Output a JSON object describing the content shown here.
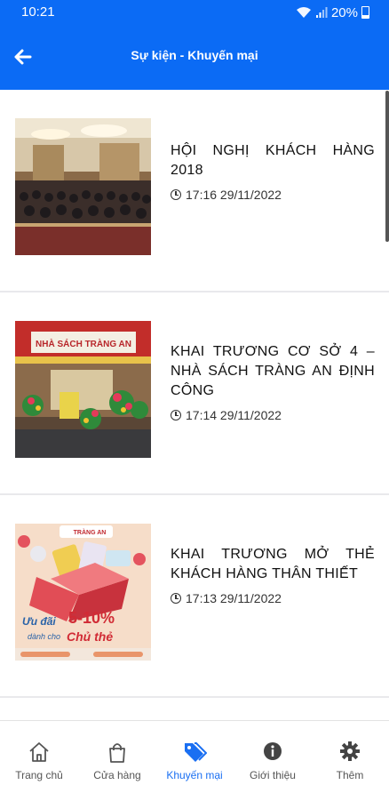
{
  "status_bar": {
    "time": "10:21",
    "battery": "20%"
  },
  "header": {
    "title": "Sự kiện - Khuyến mại",
    "back_icon": "arrow-left-icon"
  },
  "articles": [
    {
      "title": "HỘI NGHỊ KHÁCH HÀNG 2018",
      "time": "17:16 29/11/2022",
      "image": "conference-photo"
    },
    {
      "title": "KHAI TRƯƠNG CƠ SỞ 4 – NHÀ SÁCH TRÀNG AN ĐỊNH CÔNG",
      "time": "17:14 29/11/2022",
      "image": "store-opening-photo",
      "image_text": "NHÀ SÁCH TRÀNG AN"
    },
    {
      "title": "KHAI TRƯƠNG MỞ THẺ KHÁCH HÀNG THÂN THIẾT",
      "time": "17:13 29/11/2022",
      "image": "membership-card-promo",
      "image_text": {
        "brand": "TRÀNG AN",
        "promo_a": "Ưu đãi",
        "promo_b": "5-10%",
        "promo_c": "dành cho",
        "promo_d": "Chủ thẻ"
      }
    }
  ],
  "bottom_nav": [
    {
      "label": "Trang chủ",
      "icon": "home-icon"
    },
    {
      "label": "Cửa hàng",
      "icon": "shopping-bag-icon"
    },
    {
      "label": "Khuyến mại",
      "icon": "tags-icon",
      "active": true
    },
    {
      "label": "Giới thiệu",
      "icon": "info-icon"
    },
    {
      "label": "Thêm",
      "icon": "gear-icon"
    }
  ],
  "colors": {
    "primary": "#0b6bf5",
    "active_nav": "#1a6ff2",
    "background": "#e9e9ec"
  }
}
